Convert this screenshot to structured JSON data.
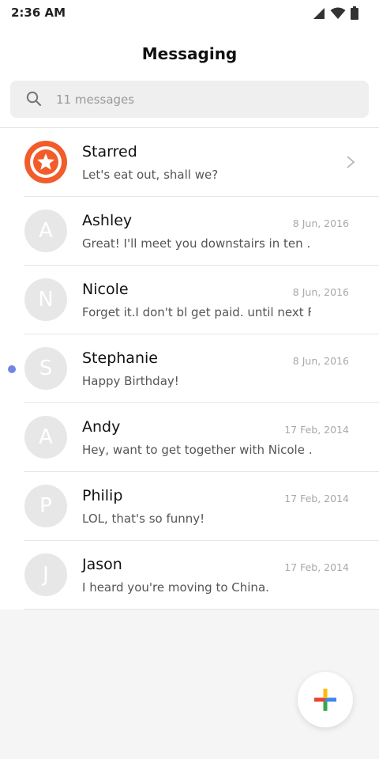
{
  "status_bar": {
    "time": "2:36 AM",
    "icons": [
      "signal-icon",
      "wifi-icon",
      "battery-icon"
    ]
  },
  "header": {
    "title": "Messaging"
  },
  "search": {
    "placeholder": "11 messages"
  },
  "starred": {
    "name": "Starred",
    "preview": "Let's eat out, shall we?",
    "icon": "star-icon"
  },
  "conversations": [
    {
      "initial": "A",
      "name": "Ashley",
      "preview": "Great! I'll meet you downstairs in ten …",
      "date": "8 Jun, 2016",
      "unread": false
    },
    {
      "initial": "N",
      "name": "Nicole",
      "preview": "Forget it.I don't bl get paid. until next F…",
      "date": "8 Jun, 2016",
      "unread": false
    },
    {
      "initial": "S",
      "name": "Stephanie",
      "preview": "Happy Birthday!",
      "date": "8 Jun, 2016",
      "unread": true
    },
    {
      "initial": "A",
      "name": "Andy",
      "preview": "Hey, want to get together with Nicole …",
      "date": "17 Feb, 2014",
      "unread": false
    },
    {
      "initial": "P",
      "name": "Philip",
      "preview": "LOL, that's so funny!",
      "date": "17 Feb, 2014",
      "unread": false
    },
    {
      "initial": "J",
      "name": "Jason",
      "preview": "I heard you're moving to China.",
      "date": "17 Feb, 2014",
      "unread": false
    }
  ],
  "fab": {
    "icon": "plus-icon"
  },
  "colors": {
    "starred": "#f25c2a",
    "unread_dot": "#6f86e6",
    "avatar_bg": "#e7e7e7",
    "plus_blue": "#4285f4",
    "plus_red": "#ea4335",
    "plus_yellow": "#fbbc05",
    "plus_green": "#34a853"
  }
}
